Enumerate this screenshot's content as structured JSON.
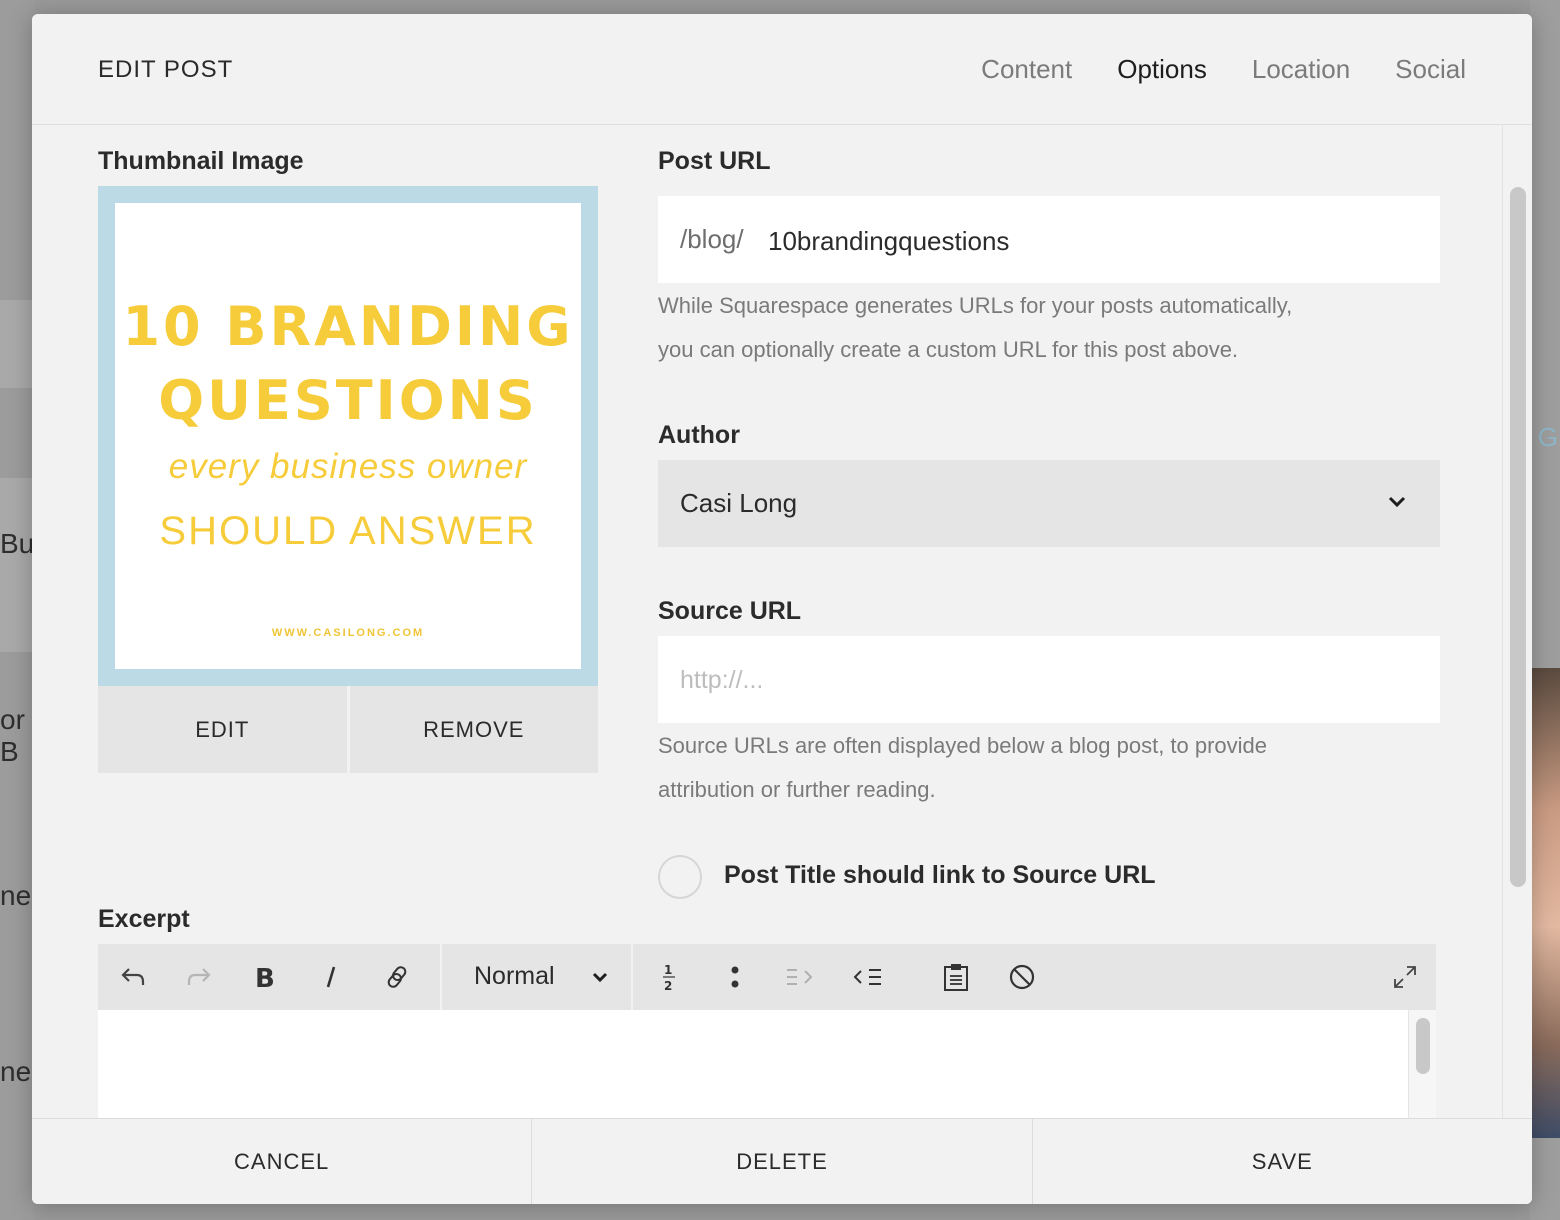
{
  "background": {
    "left_fragments": [
      "Bus",
      "or B",
      "ne",
      "ne"
    ],
    "right_fragment": "G"
  },
  "modal": {
    "title": "EDIT POST",
    "tabs": [
      {
        "label": "Content",
        "active": false
      },
      {
        "label": "Options",
        "active": true
      },
      {
        "label": "Location",
        "active": false
      },
      {
        "label": "Social",
        "active": false
      }
    ]
  },
  "thumbnail": {
    "label": "Thumbnail Image",
    "image_text": {
      "line1": "10 BRANDING",
      "line2": "QUESTIONS",
      "line3": "every business owner",
      "line4": "SHOULD ANSWER",
      "site": "WWW.CASILONG.COM"
    },
    "edit_label": "EDIT",
    "remove_label": "REMOVE"
  },
  "post_url": {
    "label": "Post URL",
    "prefix": "/blog/",
    "value": "10brandingquestions",
    "help_line1": "While Squarespace generates URLs for your posts automatically,",
    "help_line2": "you can optionally create a custom URL for this post above."
  },
  "author": {
    "label": "Author",
    "selected": "Casi Long"
  },
  "source_url": {
    "label": "Source URL",
    "placeholder": "http://...",
    "help_line1": "Source URLs are often displayed below a blog post, to provide",
    "help_line2": "attribution or further reading."
  },
  "link_toggle": {
    "label": "Post Title should link to Source URL",
    "checked": false
  },
  "excerpt": {
    "label": "Excerpt",
    "format": "Normal",
    "content": ""
  },
  "footer": {
    "cancel": "CANCEL",
    "delete": "DELETE",
    "save": "SAVE"
  },
  "colors": {
    "thumb_border": "#bcd9e6",
    "thumb_text": "#f6cc3a",
    "modal_bg": "#f2f2f2"
  }
}
